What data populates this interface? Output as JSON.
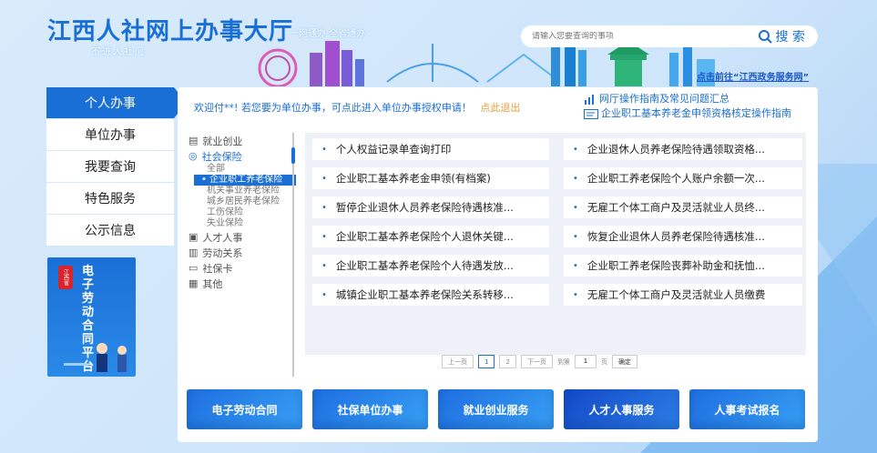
{
  "header": {
    "title": "江西人社网上办事大厅",
    "tagline": "一网通办 全省通办",
    "subtitle": "不进人社门",
    "search_placeholder": "请输入您要查询的事项",
    "search_label": "搜 索",
    "gov_link": "点击前往“江西政务服务网”"
  },
  "nav": {
    "items": [
      {
        "label": "个人办事"
      },
      {
        "label": "单位办事"
      },
      {
        "label": "我要查询"
      },
      {
        "label": "特色服务"
      },
      {
        "label": "公示信息"
      }
    ],
    "banner_badge": "江西省",
    "banner_text": "电子劳动合同平台"
  },
  "main": {
    "welcome": "欢迎付**!",
    "unit_notice": "若您要为单位办事，可点此进入单位办事授权申请！",
    "logout": "点此退出",
    "help_links": [
      "网厅操作指南及常见问题汇总",
      "企业职工基本养老金申领资格核定操作指南"
    ],
    "categories": [
      {
        "label": "就业创业"
      },
      {
        "label": "社会保险"
      }
    ],
    "sub_categories": [
      "全部",
      "企业职工养老保险",
      "机关事业养老保险",
      "城乡居民养老保险",
      "工伤保险",
      "失业保险"
    ],
    "categories_after": [
      {
        "label": "人才人事"
      },
      {
        "label": "劳动关系"
      },
      {
        "label": "社保卡"
      },
      {
        "label": "其他"
      }
    ],
    "services": [
      "个人权益记录单查询打印",
      "企业退休人员养老保险待遇领取资格...",
      "企业职工基本养老金申领(有档案)",
      "企业职工养老保险个人账户余额一次...",
      "暂停企业退休人员养老保险待遇核准...",
      "无雇工个体工商户及灵活就业人员终...",
      "企业职工基本养老保险个人退休关键...",
      "恢复企业退休人员养老保险待遇核准...",
      "企业职工基本养老保险个人待遇发放...",
      "企业职工养老保险丧葬补助金和抚恤...",
      "城镇企业职工基本养老保险关系转移...",
      "无雇工个体工商户及灵活就业人员缴费"
    ],
    "pager": {
      "prev": "上一页",
      "pages": [
        "1",
        "2"
      ],
      "next": "下一页",
      "goto": "到第",
      "goto_value": "1",
      "page_unit": "页",
      "confirm": "确定"
    },
    "tiles": [
      "电子劳动合同",
      "社保单位办事",
      "就业创业服务",
      "人才人事服务",
      "人事考试报名"
    ]
  },
  "colors": {
    "primary": "#1a6fd6",
    "warn": "#e6a23c",
    "banner_badge": "#d9242b"
  }
}
